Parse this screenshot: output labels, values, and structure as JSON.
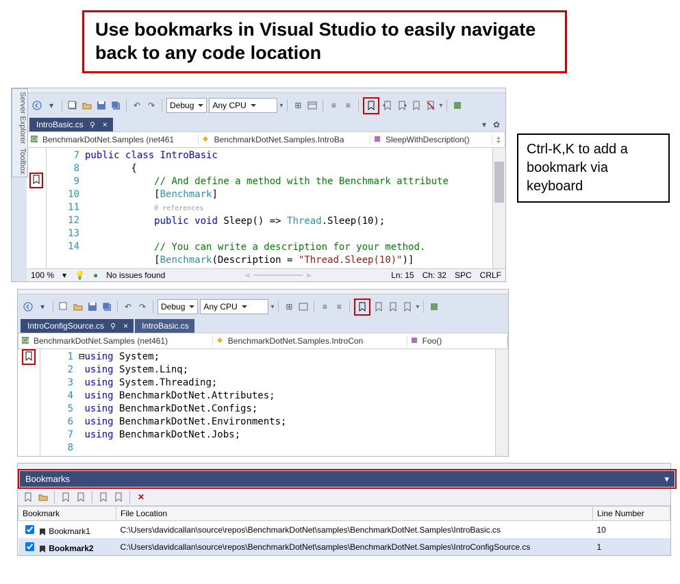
{
  "title": "Use bookmarks in Visual Studio to easily navigate back to any code location",
  "callout": "Ctrl-K,K to add a bookmark via keyboard",
  "toolbar": {
    "config": "Debug",
    "platform": "Any CPU"
  },
  "panel1": {
    "tab": "IntroBasic.cs",
    "bc1": "BenchmarkDotNet.Samples (net461",
    "bc2": "BenchmarkDotNet.Samples.IntroBa",
    "bc3": "SleepWithDescription()",
    "lines": [
      "7",
      "8",
      "9",
      "10",
      "",
      "11",
      "12",
      "13",
      "14"
    ],
    "code7": "public class IntroBasic",
    "code8": "{",
    "code9a": "// And define a method with the Benchmark attribute",
    "code9b_open": "[",
    "code9b_type": "Benchmark",
    "code9b_close": "]",
    "coderef": "0 references",
    "code11_kw1": "public",
    "code11_kw2": "void",
    "code11_name": " Sleep() => ",
    "code11_type": "Thread",
    "code11_rest": ".Sleep(10);",
    "code13": "// You can write a description for your method.",
    "code14_open": "[",
    "code14_type": "Benchmark",
    "code14_mid": "(Description = ",
    "code14_str": "\"Thread.Sleep(10)\"",
    "code14_close": ")]",
    "status_zoom": "100 %",
    "status_issues": "No issues found",
    "status_ln": "Ln: 15",
    "status_ch": "Ch: 32",
    "status_spc": "SPC",
    "status_crlf": "CRLF"
  },
  "panel2": {
    "tab1": "IntroConfigSource.cs",
    "tab2": "IntroBasic.cs",
    "bc1": "BenchmarkDotNet.Samples (net461)",
    "bc2": "BenchmarkDotNet.Samples.IntroCon",
    "bc3": "Foo()",
    "lines": [
      "1",
      "2",
      "3",
      "4",
      "5",
      "6",
      "7",
      "8"
    ],
    "using": "using",
    "ns1": " System;",
    "ns2": " System.Linq;",
    "ns3": " System.Threading;",
    "ns4": " BenchmarkDotNet.Attributes;",
    "ns5": " BenchmarkDotNet.Configs;",
    "ns6": " BenchmarkDotNet.Environments;",
    "ns7": " BenchmarkDotNet.Jobs;"
  },
  "panel3": {
    "title": "Bookmarks",
    "col1": "Bookmark",
    "col2": "File Location",
    "col3": "Line Number",
    "r1name": "Bookmark1",
    "r1path": "C:\\Users\\davidcallan\\source\\repos\\BenchmarkDotNet\\samples\\BenchmarkDotNet.Samples\\IntroBasic.cs",
    "r1line": "10",
    "r2name": "Bookmark2",
    "r2path": "C:\\Users\\davidcallan\\source\\repos\\BenchmarkDotNet\\samples\\BenchmarkDotNet.Samples\\IntroConfigSource.cs",
    "r2line": "1"
  }
}
